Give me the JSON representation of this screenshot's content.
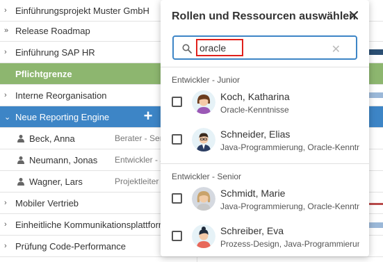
{
  "projects": [
    {
      "name": "Einführungsprojekt Muster GmbH",
      "chevron": "›"
    },
    {
      "name": "Release Roadmap",
      "chevron": "»"
    },
    {
      "name": "Einführung SAP HR",
      "chevron": "›"
    },
    {
      "name": "Pflichtgrenze",
      "chevron": ""
    },
    {
      "name": "Interne Reorganisation",
      "chevron": "›"
    },
    {
      "name": "Neue Reporting Engine",
      "chevron": "⌄"
    },
    {
      "name": "Beck, Anna",
      "role": "Berater - Senior"
    },
    {
      "name": "Neumann, Jonas",
      "role": "Entwickler - Junior"
    },
    {
      "name": "Wagner, Lars",
      "role": "Projektleiter"
    },
    {
      "name": "Mobiler Vertrieb",
      "chevron": "›"
    },
    {
      "name": "Einheitliche Kommunikationsplattform",
      "chevron": "›"
    },
    {
      "name": "Prüfung Code-Performance",
      "chevron": "›"
    }
  ],
  "add_button": "+",
  "dialog": {
    "title": "Rollen und Ressourcen auswählen",
    "search_value": "oracle",
    "clear": "✕",
    "groups": [
      {
        "label": "Entwickler - Junior",
        "people": [
          {
            "name": "Koch, Katharina",
            "skills": "Oracle-Kenntnisse"
          },
          {
            "name": "Schneider, Elias",
            "skills": "Java-Programmierung, Oracle-Kenntnisse"
          }
        ]
      },
      {
        "label": "Entwickler - Senior",
        "people": [
          {
            "name": "Schmidt, Marie",
            "skills": "Java-Programmierung, Oracle-Kenntnisse"
          },
          {
            "name": "Schreiber, Eva",
            "skills": "Prozess-Design, Java-Programmierung"
          }
        ]
      }
    ]
  },
  "colors": {
    "selected_row": "#3d85c6",
    "milestone_row": "#8db66f",
    "search_highlight": "#e0201b"
  }
}
